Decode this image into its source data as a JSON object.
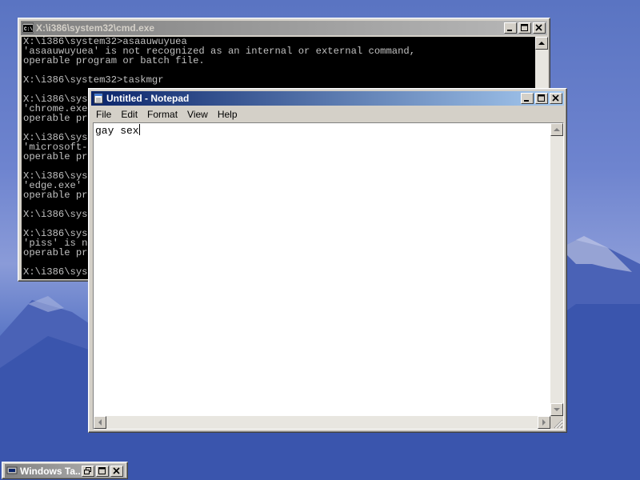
{
  "cmd_window": {
    "title": "X:\\i386\\system32\\cmd.exe",
    "lines": [
      "X:\\i386\\system32>asaauwuyuea",
      "'asaauwuyuea' is not recognized as an internal or external command,",
      "operable program or batch file.",
      "",
      "X:\\i386\\system32>taskmgr",
      "",
      "X:\\i386\\sys",
      "'chrome.exe",
      "operable pr",
      "",
      "X:\\i386\\sys",
      "'microsoft-",
      "operable pr",
      "",
      "X:\\i386\\sys",
      "'edge.exe'",
      "operable pr",
      "",
      "X:\\i386\\sys",
      "",
      "X:\\i386\\sys",
      "'piss' is n",
      "operable pr",
      "",
      "X:\\i386\\sys"
    ]
  },
  "notepad": {
    "title": "Untitled - Notepad",
    "menu": [
      "File",
      "Edit",
      "Format",
      "View",
      "Help"
    ],
    "content": "gay sex"
  },
  "minimized_window": {
    "title": "Windows Ta..."
  },
  "colors": {
    "active_title": "#0a246a",
    "inactive_title": "#808080",
    "window_face": "#d4d0c8"
  },
  "icons": {
    "cmd": "console-icon",
    "notepad": "notepad-icon",
    "taskmgr": "computer-icon"
  }
}
